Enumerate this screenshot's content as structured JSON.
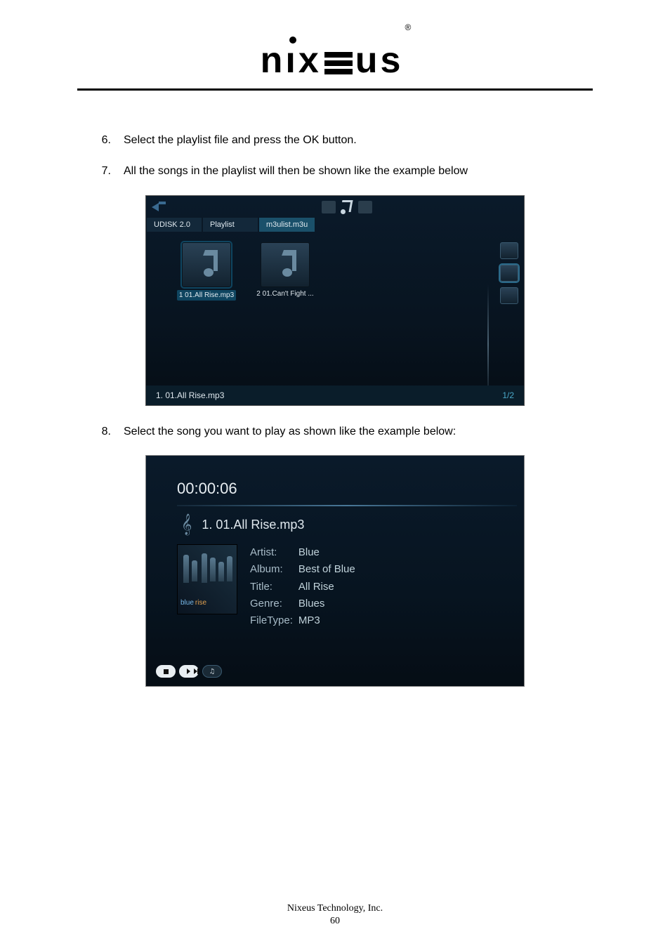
{
  "logo": {
    "brand": "nixeus",
    "reg": "®"
  },
  "steps": [
    {
      "n": "6.",
      "text": "Select the playlist file and press the OK button."
    },
    {
      "n": "7.",
      "text": "All the songs in the playlist will then be shown like the example below"
    },
    {
      "n": "8.",
      "text": "Select the song you want to play as shown like the example below:"
    }
  ],
  "shot1": {
    "breadcrumb": [
      "UDISK 2.0",
      "Playlist",
      "m3ulist.m3u"
    ],
    "files": [
      {
        "label": "1 01.All Rise.mp3",
        "selected": true
      },
      {
        "label": "2 01.Can't Fight ...",
        "selected": false
      }
    ],
    "footer_file": "1. 01.All Rise.mp3",
    "footer_page": "1/2"
  },
  "shot2": {
    "time": "00:00:06",
    "now_playing": "1. 01.All Rise.mp3",
    "cover_text1": "blue",
    "cover_text2": "rise",
    "meta": {
      "Artist": "Blue",
      "Album": "Best of Blue",
      "Title": "All Rise",
      "Genre": "Blues",
      "FileType": "MP3"
    },
    "meta_labels": [
      "Artist:",
      "Album:",
      "Title:",
      "Genre:",
      "FileType:"
    ],
    "controls": {
      "loop": "♫"
    }
  },
  "footer": {
    "company": "Nixeus Technology, Inc.",
    "page": "60"
  }
}
